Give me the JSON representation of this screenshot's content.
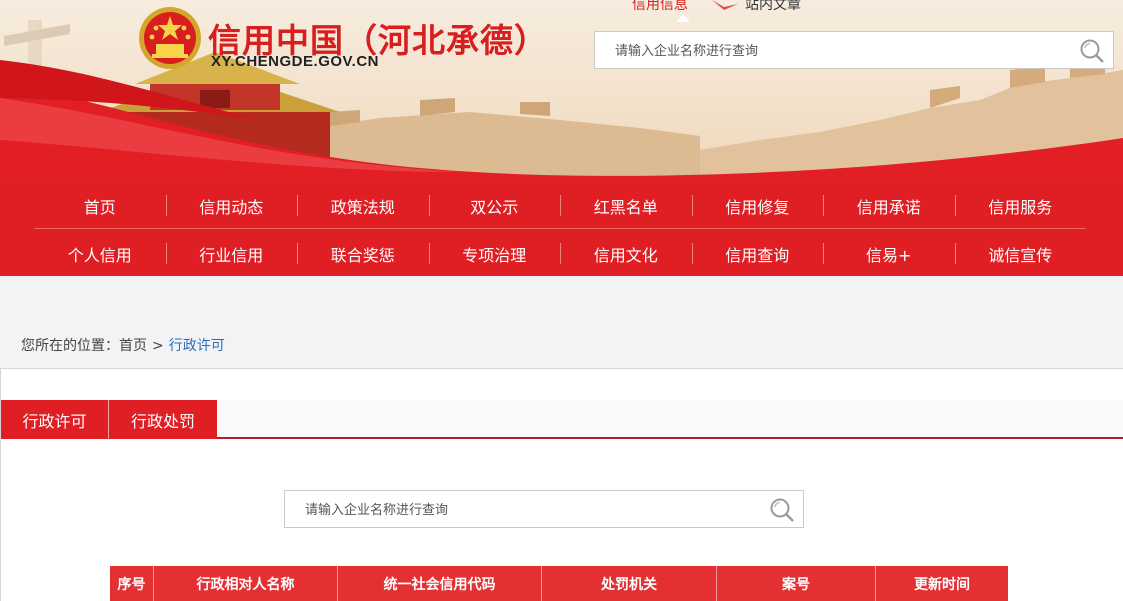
{
  "header": {
    "title": "信用中国（河北承德）",
    "url": "XY.CHENGDE.GOV.CN",
    "search_tabs": [
      "信用信息",
      "站内文章"
    ],
    "search_placeholder": "请输入企业名称进行查询",
    "emblem_icon": "national-emblem-icon",
    "search_icon": "search-icon"
  },
  "nav": {
    "row1": [
      "首页",
      "信用动态",
      "政策法规",
      "双公示",
      "红黑名单",
      "信用修复",
      "信用承诺",
      "信用服务"
    ],
    "row2": [
      "个人信用",
      "行业信用",
      "联合奖惩",
      "专项治理",
      "信用文化",
      "信用查询",
      "信易+",
      "诚信宣传"
    ]
  },
  "breadcrumb": {
    "prefix": "您所在的位置：",
    "home": "首页",
    "separator": ">",
    "current": "行政许可"
  },
  "tabs": [
    "行政许可",
    "行政处罚"
  ],
  "search": {
    "placeholder": "请输入企业名称进行查询"
  },
  "table": {
    "columns": [
      "序号",
      "行政相对人名称",
      "统一社会信用代码",
      "处罚机关",
      "案号",
      "更新时间"
    ]
  },
  "colors": {
    "brand_red": "#e01f25",
    "dark_red": "#b71c22",
    "link_blue": "#2a6fb8"
  }
}
